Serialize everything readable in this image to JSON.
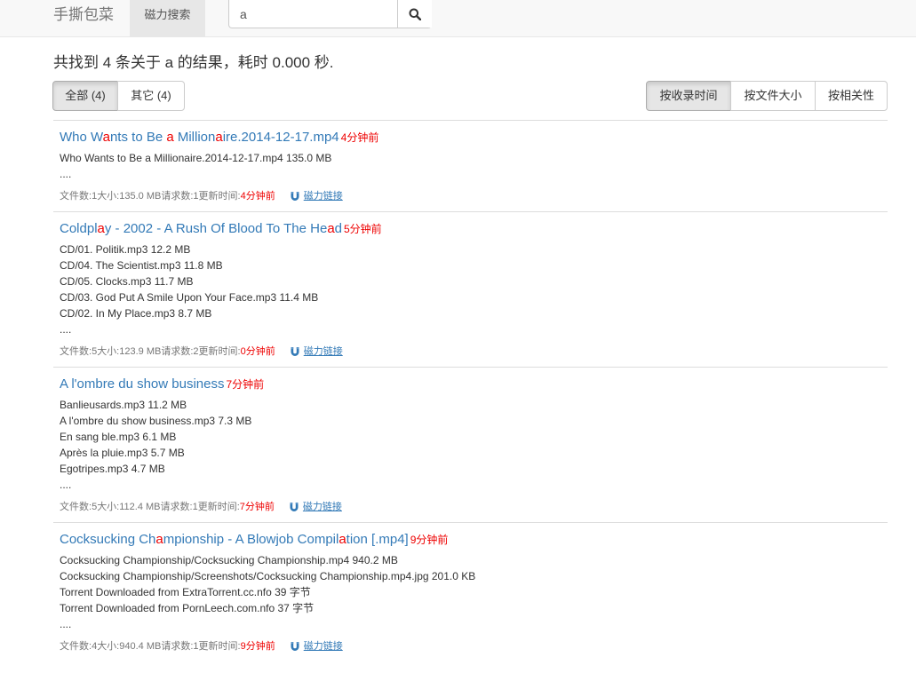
{
  "nav": {
    "brand": "手撕包菜",
    "tab": "磁力搜索",
    "search_value": "a"
  },
  "summary": "共找到 4 条关于 a 的结果，耗时 0.000 秒.",
  "filters": {
    "all": "全部 (4)",
    "other": "其它 (4)"
  },
  "sort": {
    "time": "按收录时间",
    "size": "按文件大小",
    "relevance": "按相关性"
  },
  "labels": {
    "files": "文件数: ",
    "size": " 大小: ",
    "requests": " 请求数: ",
    "updated": " 更新时间: ",
    "magnet": "磁力链接"
  },
  "colors": {
    "link": "#337ab7",
    "highlight": "#ee0000",
    "meta": "#777777"
  },
  "results": [
    {
      "title_parts": [
        {
          "t": "Who W",
          "h": false
        },
        {
          "t": "a",
          "h": true
        },
        {
          "t": "nts to Be ",
          "h": false
        },
        {
          "t": "a",
          "h": true
        },
        {
          "t": " Million",
          "h": false
        },
        {
          "t": "a",
          "h": true
        },
        {
          "t": "ire.2014-12-17.mp4",
          "h": false
        }
      ],
      "age": "4分钟前",
      "files": [
        "Who Wants to Be a Millionaire.2014-12-17.mp4 135.0 MB",
        "...."
      ],
      "file_count": "1",
      "size": "135.0 MB",
      "requests": "1",
      "updated": "4分钟前"
    },
    {
      "title_parts": [
        {
          "t": "Coldpl",
          "h": false
        },
        {
          "t": "a",
          "h": true
        },
        {
          "t": "y - 2002 - A Rush Of Blood To The He",
          "h": false
        },
        {
          "t": "a",
          "h": true
        },
        {
          "t": "d",
          "h": false
        }
      ],
      "age": "5分钟前",
      "files": [
        "CD/01. Politik.mp3 12.2 MB",
        "CD/04. The Scientist.mp3 11.8 MB",
        "CD/05. Clocks.mp3 11.7 MB",
        "CD/03. God Put A Smile Upon Your Face.mp3 11.4 MB",
        "CD/02. In My Place.mp3 8.7 MB",
        "...."
      ],
      "file_count": "5",
      "size": "123.9 MB",
      "requests": "2",
      "updated": "0分钟前"
    },
    {
      "title_parts": [
        {
          "t": "A l'ombre du show business",
          "h": false
        }
      ],
      "age": "7分钟前",
      "files": [
        "Banlieusards.mp3 11.2 MB",
        "A l'ombre du show business.mp3 7.3 MB",
        "En sang ble.mp3 6.1 MB",
        "Après la pluie.mp3 5.7 MB",
        "Egotripes.mp3 4.7 MB",
        "...."
      ],
      "file_count": "5",
      "size": "112.4 MB",
      "requests": "1",
      "updated": "7分钟前"
    },
    {
      "title_parts": [
        {
          "t": "Cocksucking Ch",
          "h": false
        },
        {
          "t": "a",
          "h": true
        },
        {
          "t": "mpionship - A Blowjob Compil",
          "h": false
        },
        {
          "t": "a",
          "h": true
        },
        {
          "t": "tion [.mp4]",
          "h": false
        }
      ],
      "age": "9分钟前",
      "files": [
        "Cocksucking Championship/Cocksucking Championship.mp4 940.2 MB",
        "Cocksucking Championship/Screenshots/Cocksucking Championship.mp4.jpg 201.0 KB",
        "Torrent Downloaded from ExtraTorrent.cc.nfo 39 字节",
        "Torrent Downloaded from PornLeech.com.nfo 37 字节",
        "...."
      ],
      "file_count": "4",
      "size": "940.4 MB",
      "requests": "1",
      "updated": "9分钟前"
    }
  ]
}
